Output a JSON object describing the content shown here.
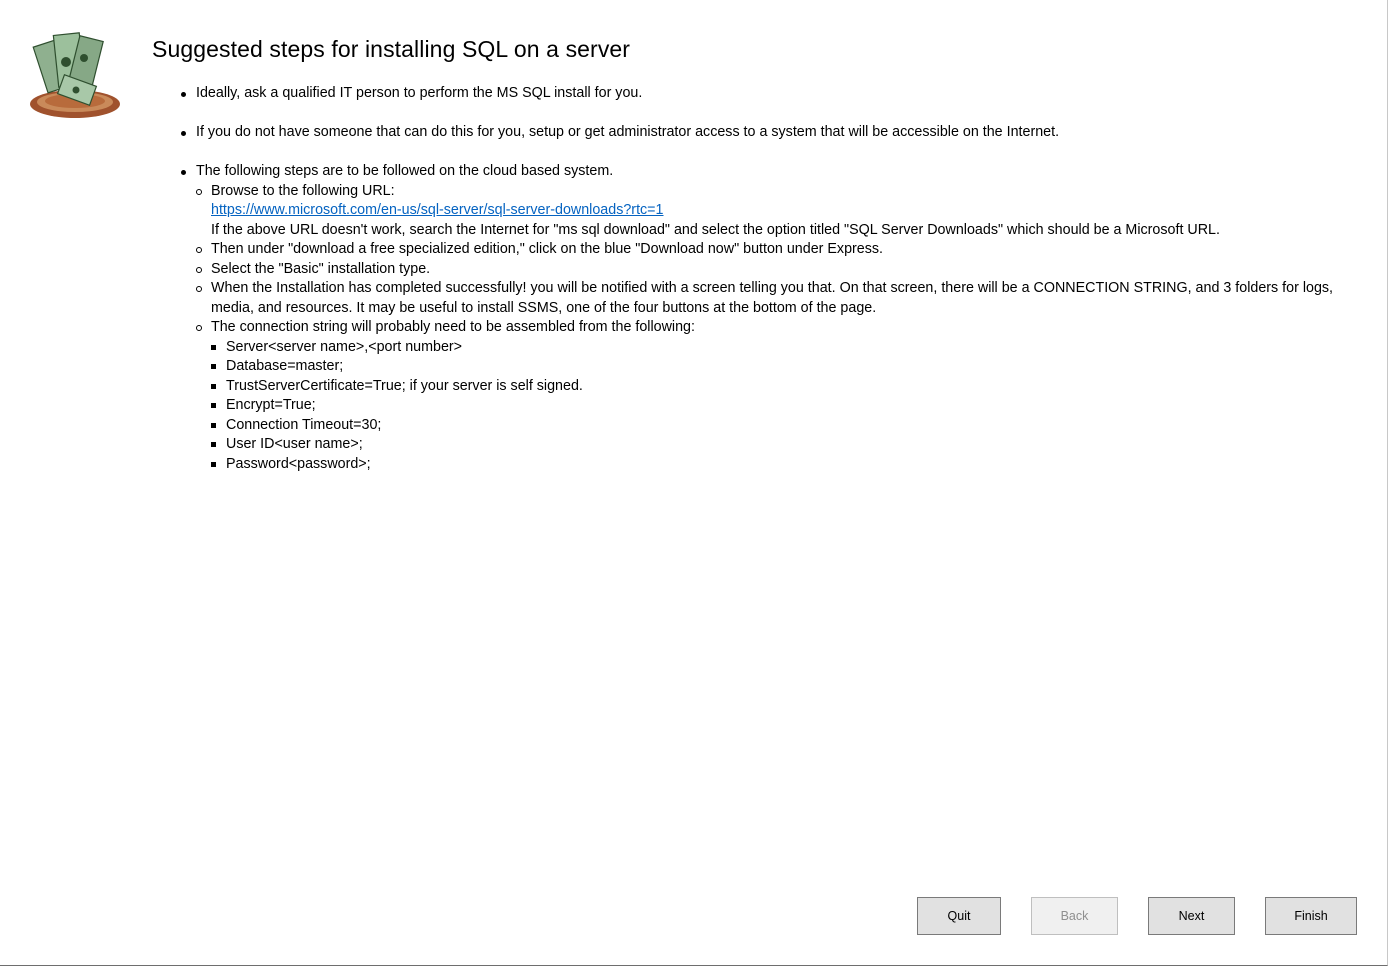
{
  "header": {
    "logo_icon": "money-pile-icon",
    "title": "Suggested steps for installing SQL on a server"
  },
  "steps": {
    "step1": "Ideally, ask a qualified IT person to perform the MS SQL install for you.",
    "step2": "If you do not have someone that can do this for you, setup or get administrator access to a system that will be accessible on the Internet.",
    "step3": "The following steps are to be followed on the cloud based system.",
    "substeps": {
      "browse_label": "Browse to the following URL:",
      "browse_url": "https://www.microsoft.com/en-us/sql-server/sql-server-downloads?rtc=1",
      "browse_fallback": "If the above URL doesn't work, search the Internet for \"ms sql download\" and select the option titled \"SQL Server Downloads\" which should be a Microsoft URL.",
      "download": "Then under \"download a free specialized edition,\" click on the blue \"Download now\" button under Express.",
      "basic": "Select the \"Basic\" installation type.",
      "completed": "When the Installation has completed successfully! you will be notified with a screen telling you that. On that screen, there will be a CONNECTION STRING, and 3 folders for logs, media, and resources. It may be useful to install SSMS, one of the four buttons at the bottom of the page.",
      "connection": "The connection string will probably need to be assembled from the following:",
      "connection_parts": [
        "Server<server name>,<port number>",
        "Database=master;",
        "TrustServerCertificate=True; if your server is self signed.",
        "Encrypt=True;",
        "Connection Timeout=30;",
        "User ID<user name>;",
        "Password<password>;"
      ]
    }
  },
  "buttons": {
    "quit": "Quit",
    "back": "Back",
    "next": "Next",
    "finish": "Finish"
  },
  "colors": {
    "link": "#0563c1",
    "button_bg": "#e1e1e1",
    "button_disabled_text": "#8f8f8f"
  }
}
